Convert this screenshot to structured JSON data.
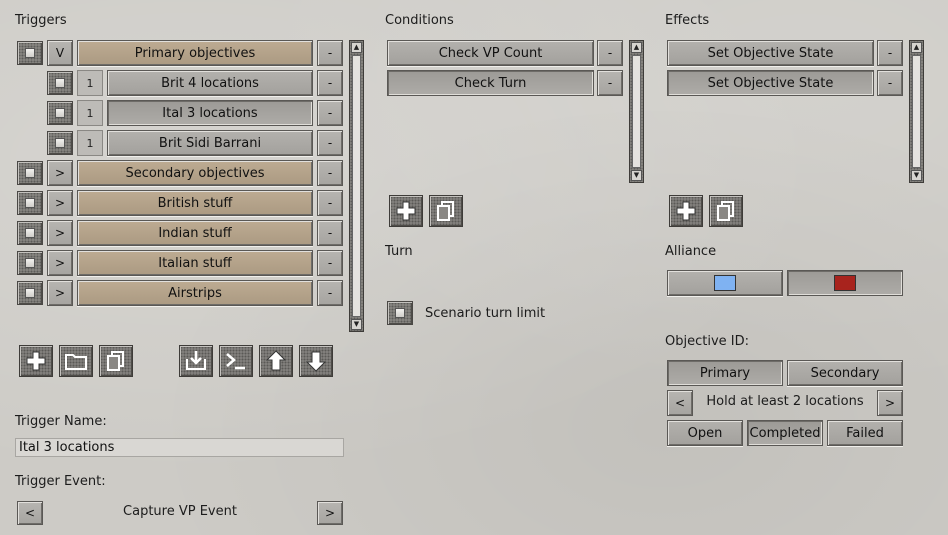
{
  "triggers": {
    "title": "Triggers",
    "rows": [
      {
        "toggle": "V",
        "label": "Primary objectives",
        "style": "tan",
        "indent": false
      },
      {
        "toggle": "1",
        "label": "Brit 4 locations",
        "style": "grey",
        "indent": true
      },
      {
        "toggle": "1",
        "label": "Ital 3 locations",
        "style": "grey",
        "indent": true,
        "selected": true
      },
      {
        "toggle": "1",
        "label": "Brit Sidi Barrani",
        "style": "grey",
        "indent": true
      },
      {
        "toggle": ">",
        "label": "Secondary objectives",
        "style": "tan",
        "indent": false
      },
      {
        "toggle": ">",
        "label": "British stuff",
        "style": "tan",
        "indent": false
      },
      {
        "toggle": ">",
        "label": "Indian stuff",
        "style": "tan",
        "indent": false
      },
      {
        "toggle": ">",
        "label": "Italian stuff",
        "style": "tan",
        "indent": false
      },
      {
        "toggle": ">",
        "label": "Airstrips",
        "style": "tan",
        "indent": false
      }
    ],
    "remove_label": "-",
    "toolbar_icons": [
      "add-icon",
      "folder-icon",
      "copy-icon",
      "import-icon",
      "console-icon",
      "arrow-up-icon",
      "arrow-down-icon"
    ]
  },
  "trigger_name": {
    "label": "Trigger Name:",
    "value": "Ital 3 locations"
  },
  "trigger_event": {
    "label": "Trigger Event:",
    "value": "Capture VP Event",
    "prev": "<",
    "next": ">"
  },
  "conditions": {
    "title": "Conditions",
    "items": [
      "Check VP Count",
      "Check Turn"
    ],
    "remove_label": "-",
    "toolbar_icons": [
      "add-icon",
      "copy-icon"
    ]
  },
  "turn": {
    "title": "Turn",
    "checkbox_label": "Scenario turn limit"
  },
  "effects": {
    "title": "Effects",
    "items": [
      "Set Objective State",
      "Set Objective State"
    ],
    "remove_label": "-",
    "toolbar_icons": [
      "add-icon",
      "copy-icon"
    ]
  },
  "alliance": {
    "title": "Alliance",
    "colors": [
      "#7fb2f2",
      "#a8231d"
    ]
  },
  "objective": {
    "title": "Objective ID:",
    "types": [
      "Primary",
      "Secondary"
    ],
    "selected_type": "Primary",
    "description": "Hold at least 2 locations",
    "prev": "<",
    "next": ">",
    "states": [
      "Open",
      "Completed",
      "Failed"
    ],
    "selected_state": "Completed"
  }
}
